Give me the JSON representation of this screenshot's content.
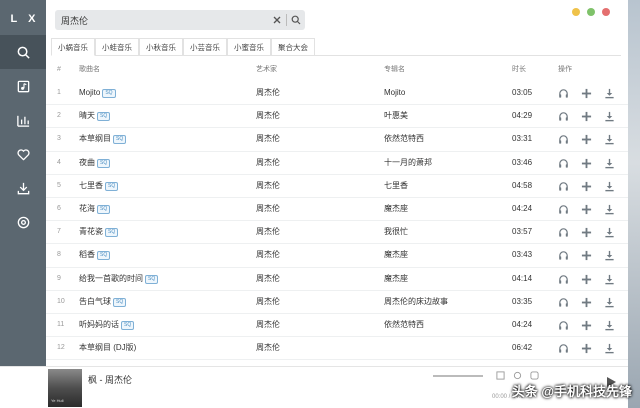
{
  "app": {
    "logo": "L X"
  },
  "sidebar": {
    "items": [
      {
        "name": "search",
        "active": true
      },
      {
        "name": "playlist"
      },
      {
        "name": "charts"
      },
      {
        "name": "favorites"
      },
      {
        "name": "download"
      },
      {
        "name": "settings"
      }
    ]
  },
  "search": {
    "value": "周杰伦"
  },
  "tabs": [
    "小蜗音乐",
    "小蛙音乐",
    "小秋音乐",
    "小芸音乐",
    "小蜜音乐",
    "聚合大会"
  ],
  "columns": {
    "idx": "#",
    "name": "歌曲名",
    "artist": "艺术家",
    "album": "专辑名",
    "time": "时长",
    "ops": "操作"
  },
  "songs": [
    {
      "idx": "1",
      "name": "Mojito",
      "sq": "SQ",
      "artist": "周杰伦",
      "album": "Mojito",
      "time": "03:05"
    },
    {
      "idx": "2",
      "name": "晴天",
      "sq": "SQ",
      "artist": "周杰伦",
      "album": "叶惠美",
      "time": "04:29"
    },
    {
      "idx": "3",
      "name": "本草纲目",
      "sq": "SQ",
      "artist": "周杰伦",
      "album": "依然范特西",
      "time": "03:31"
    },
    {
      "idx": "4",
      "name": "夜曲",
      "sq": "SQ",
      "artist": "周杰伦",
      "album": "十一月的萧邦",
      "time": "03:46"
    },
    {
      "idx": "5",
      "name": "七里香",
      "sq": "SQ",
      "artist": "周杰伦",
      "album": "七里香",
      "time": "04:58"
    },
    {
      "idx": "6",
      "name": "花海",
      "sq": "SQ",
      "artist": "周杰伦",
      "album": "魔杰座",
      "time": "04:24"
    },
    {
      "idx": "7",
      "name": "青花瓷",
      "sq": "SQ",
      "artist": "周杰伦",
      "album": "我很忙",
      "time": "03:57"
    },
    {
      "idx": "8",
      "name": "稻香",
      "sq": "SQ",
      "artist": "周杰伦",
      "album": "魔杰座",
      "time": "03:43"
    },
    {
      "idx": "9",
      "name": "给我一首歌的时间",
      "sq": "SQ",
      "artist": "周杰伦",
      "album": "魔杰座",
      "time": "04:14"
    },
    {
      "idx": "10",
      "name": "告白气球",
      "sq": "SQ",
      "artist": "周杰伦",
      "album": "周杰伦的床边故事",
      "time": "03:35"
    },
    {
      "idx": "11",
      "name": "听妈妈的话",
      "sq": "SQ",
      "artist": "周杰伦",
      "album": "依然范特西",
      "time": "04:24"
    },
    {
      "idx": "12",
      "name": "本草纲目 (DJ版)",
      "sq": "",
      "artist": "周杰伦",
      "album": "",
      "time": "06:42"
    }
  ],
  "player": {
    "title": "枫 - 周杰伦",
    "cover_label": "Ye Huli",
    "time": "00:00 / 04:0"
  },
  "watermark": "头条 @手机科技先锋",
  "colors": {
    "sidebar": "#5b6770",
    "sidebar_active": "#47525a",
    "accent": "#4f90c2"
  }
}
